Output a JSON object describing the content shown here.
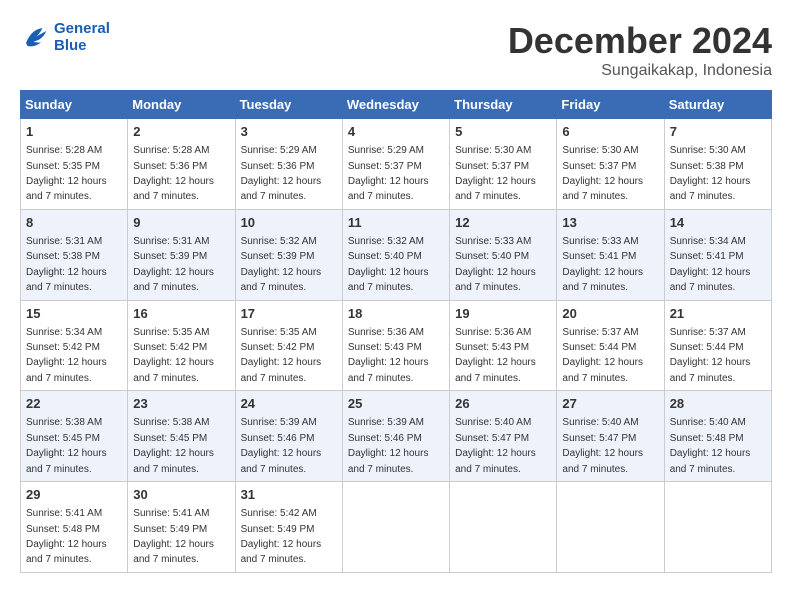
{
  "header": {
    "logo_line1": "General",
    "logo_line2": "Blue",
    "main_title": "December 2024",
    "subtitle": "Sungaikakap, Indonesia"
  },
  "weekdays": [
    "Sunday",
    "Monday",
    "Tuesday",
    "Wednesday",
    "Thursday",
    "Friday",
    "Saturday"
  ],
  "weeks": [
    [
      {
        "day": "1",
        "sunrise": "Sunrise: 5:28 AM",
        "sunset": "Sunset: 5:35 PM",
        "daylight": "Daylight: 12 hours and 7 minutes."
      },
      {
        "day": "2",
        "sunrise": "Sunrise: 5:28 AM",
        "sunset": "Sunset: 5:36 PM",
        "daylight": "Daylight: 12 hours and 7 minutes."
      },
      {
        "day": "3",
        "sunrise": "Sunrise: 5:29 AM",
        "sunset": "Sunset: 5:36 PM",
        "daylight": "Daylight: 12 hours and 7 minutes."
      },
      {
        "day": "4",
        "sunrise": "Sunrise: 5:29 AM",
        "sunset": "Sunset: 5:37 PM",
        "daylight": "Daylight: 12 hours and 7 minutes."
      },
      {
        "day": "5",
        "sunrise": "Sunrise: 5:30 AM",
        "sunset": "Sunset: 5:37 PM",
        "daylight": "Daylight: 12 hours and 7 minutes."
      },
      {
        "day": "6",
        "sunrise": "Sunrise: 5:30 AM",
        "sunset": "Sunset: 5:37 PM",
        "daylight": "Daylight: 12 hours and 7 minutes."
      },
      {
        "day": "7",
        "sunrise": "Sunrise: 5:30 AM",
        "sunset": "Sunset: 5:38 PM",
        "daylight": "Daylight: 12 hours and 7 minutes."
      }
    ],
    [
      {
        "day": "8",
        "sunrise": "Sunrise: 5:31 AM",
        "sunset": "Sunset: 5:38 PM",
        "daylight": "Daylight: 12 hours and 7 minutes."
      },
      {
        "day": "9",
        "sunrise": "Sunrise: 5:31 AM",
        "sunset": "Sunset: 5:39 PM",
        "daylight": "Daylight: 12 hours and 7 minutes."
      },
      {
        "day": "10",
        "sunrise": "Sunrise: 5:32 AM",
        "sunset": "Sunset: 5:39 PM",
        "daylight": "Daylight: 12 hours and 7 minutes."
      },
      {
        "day": "11",
        "sunrise": "Sunrise: 5:32 AM",
        "sunset": "Sunset: 5:40 PM",
        "daylight": "Daylight: 12 hours and 7 minutes."
      },
      {
        "day": "12",
        "sunrise": "Sunrise: 5:33 AM",
        "sunset": "Sunset: 5:40 PM",
        "daylight": "Daylight: 12 hours and 7 minutes."
      },
      {
        "day": "13",
        "sunrise": "Sunrise: 5:33 AM",
        "sunset": "Sunset: 5:41 PM",
        "daylight": "Daylight: 12 hours and 7 minutes."
      },
      {
        "day": "14",
        "sunrise": "Sunrise: 5:34 AM",
        "sunset": "Sunset: 5:41 PM",
        "daylight": "Daylight: 12 hours and 7 minutes."
      }
    ],
    [
      {
        "day": "15",
        "sunrise": "Sunrise: 5:34 AM",
        "sunset": "Sunset: 5:42 PM",
        "daylight": "Daylight: 12 hours and 7 minutes."
      },
      {
        "day": "16",
        "sunrise": "Sunrise: 5:35 AM",
        "sunset": "Sunset: 5:42 PM",
        "daylight": "Daylight: 12 hours and 7 minutes."
      },
      {
        "day": "17",
        "sunrise": "Sunrise: 5:35 AM",
        "sunset": "Sunset: 5:42 PM",
        "daylight": "Daylight: 12 hours and 7 minutes."
      },
      {
        "day": "18",
        "sunrise": "Sunrise: 5:36 AM",
        "sunset": "Sunset: 5:43 PM",
        "daylight": "Daylight: 12 hours and 7 minutes."
      },
      {
        "day": "19",
        "sunrise": "Sunrise: 5:36 AM",
        "sunset": "Sunset: 5:43 PM",
        "daylight": "Daylight: 12 hours and 7 minutes."
      },
      {
        "day": "20",
        "sunrise": "Sunrise: 5:37 AM",
        "sunset": "Sunset: 5:44 PM",
        "daylight": "Daylight: 12 hours and 7 minutes."
      },
      {
        "day": "21",
        "sunrise": "Sunrise: 5:37 AM",
        "sunset": "Sunset: 5:44 PM",
        "daylight": "Daylight: 12 hours and 7 minutes."
      }
    ],
    [
      {
        "day": "22",
        "sunrise": "Sunrise: 5:38 AM",
        "sunset": "Sunset: 5:45 PM",
        "daylight": "Daylight: 12 hours and 7 minutes."
      },
      {
        "day": "23",
        "sunrise": "Sunrise: 5:38 AM",
        "sunset": "Sunset: 5:45 PM",
        "daylight": "Daylight: 12 hours and 7 minutes."
      },
      {
        "day": "24",
        "sunrise": "Sunrise: 5:39 AM",
        "sunset": "Sunset: 5:46 PM",
        "daylight": "Daylight: 12 hours and 7 minutes."
      },
      {
        "day": "25",
        "sunrise": "Sunrise: 5:39 AM",
        "sunset": "Sunset: 5:46 PM",
        "daylight": "Daylight: 12 hours and 7 minutes."
      },
      {
        "day": "26",
        "sunrise": "Sunrise: 5:40 AM",
        "sunset": "Sunset: 5:47 PM",
        "daylight": "Daylight: 12 hours and 7 minutes."
      },
      {
        "day": "27",
        "sunrise": "Sunrise: 5:40 AM",
        "sunset": "Sunset: 5:47 PM",
        "daylight": "Daylight: 12 hours and 7 minutes."
      },
      {
        "day": "28",
        "sunrise": "Sunrise: 5:40 AM",
        "sunset": "Sunset: 5:48 PM",
        "daylight": "Daylight: 12 hours and 7 minutes."
      }
    ],
    [
      {
        "day": "29",
        "sunrise": "Sunrise: 5:41 AM",
        "sunset": "Sunset: 5:48 PM",
        "daylight": "Daylight: 12 hours and 7 minutes."
      },
      {
        "day": "30",
        "sunrise": "Sunrise: 5:41 AM",
        "sunset": "Sunset: 5:49 PM",
        "daylight": "Daylight: 12 hours and 7 minutes."
      },
      {
        "day": "31",
        "sunrise": "Sunrise: 5:42 AM",
        "sunset": "Sunset: 5:49 PM",
        "daylight": "Daylight: 12 hours and 7 minutes."
      },
      null,
      null,
      null,
      null
    ]
  ]
}
